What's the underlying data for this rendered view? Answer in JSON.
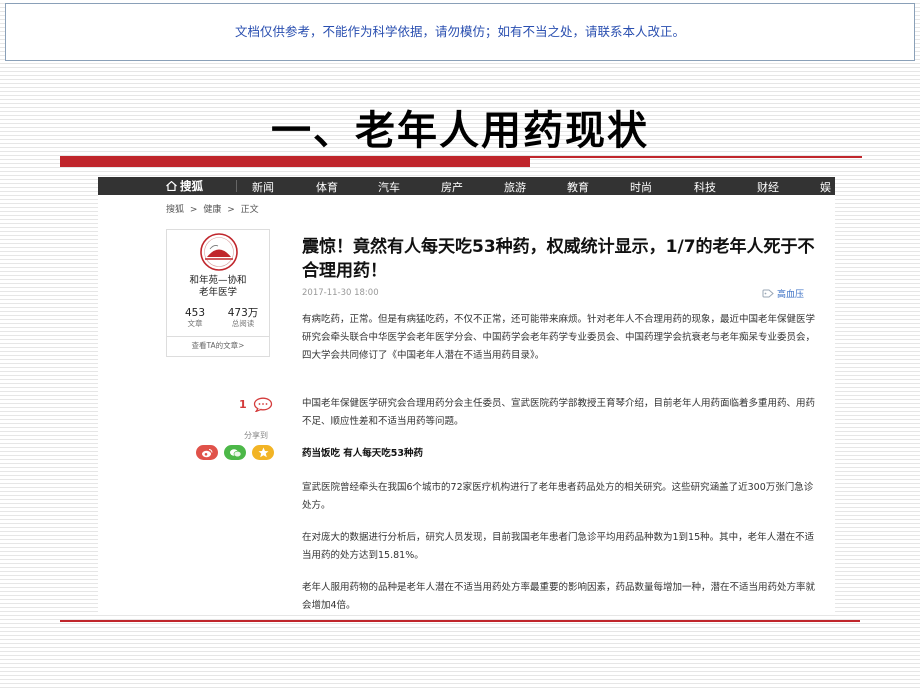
{
  "disclaimer": "文档仅供参考，不能作为科学依据，请勿模仿；如有不当之处，请联系本人改正。",
  "slide_title": "一、老年人用药现状",
  "colors": {
    "accent_red": "#c0262c",
    "nav_bg": "#333333",
    "disclaimer_blue": "#2a4fb0"
  },
  "site": {
    "logo": "搜狐",
    "nav": [
      "新闻",
      "体育",
      "汽车",
      "房产",
      "旅游",
      "教育",
      "时尚",
      "科技",
      "财经",
      "娱"
    ],
    "breadcrumb": [
      "搜狐",
      ">",
      "健康",
      ">",
      "正文"
    ]
  },
  "author": {
    "name_line1": "和年苑—协和",
    "name_line2": "老年医学",
    "articles_count": "453",
    "articles_label": "文章",
    "reads_count": "473万",
    "reads_label": "总阅读",
    "more_link": "查看TA的文章>"
  },
  "engagement": {
    "comment_count": "1",
    "share_label": "分享到"
  },
  "article": {
    "title": "震惊！竟然有人每天吃53种药，权威统计显示，1/7的老年人死于不合理用药！",
    "date": "2017-11-30 18:00",
    "tag": "高血压",
    "paragraphs": [
      "有病吃药，正常。但是有病猛吃药，不仅不正常，还可能带来麻烦。针对老年人不合理用药的现象，最近中国老年保健医学研究会牵头联合中华医学会老年医学分会、中国药学会老年药学专业委员会、中国药理学会抗衰老与老年痴呆专业委员会，四大学会共同修订了《中国老年人潜在不适当用药目录》。",
      "中国老年保健医学研究会合理用药分会主任委员、宣武医院药学部教授王育琴介绍，目前老年人用药面临着多重用药、用药不足、顺应性差和不适当用药等问题。",
      "药当饭吃 有人每天吃53种药",
      "宣武医院曾经牵头在我国6个城市的72家医疗机构进行了老年患者药品处方的相关研究。这些研究涵盖了近300万张门急诊处方。",
      "在对庞大的数据进行分析后，研究人员发现，目前我国老年患者门急诊平均用药品种数为1到15种。其中，老年人潜在不适当用药的处方达到15.81%。",
      "老年人服用药物的品种是老年人潜在不适当用药处方率最重要的影响因素，药品数量每增加一种，潜在不适当用药处方率就会增加4倍。"
    ]
  }
}
